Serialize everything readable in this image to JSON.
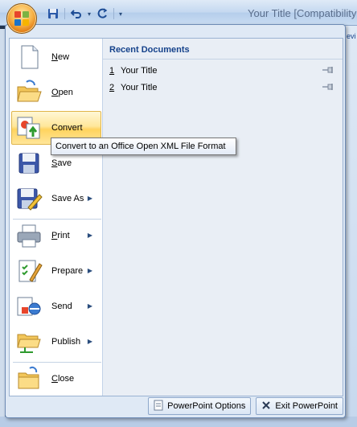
{
  "window": {
    "title": "Your Title [Compatibility"
  },
  "background": {
    "ribbon_fragment": "evi"
  },
  "menu": {
    "items": [
      {
        "label": "New",
        "mnemonic": "N",
        "rest": "ew",
        "icon": "new-document-icon",
        "submenu": false
      },
      {
        "label": "Open",
        "mnemonic": "O",
        "rest": "pen",
        "icon": "open-folder-icon",
        "submenu": false
      },
      {
        "label": "Convert",
        "mnemonic": "",
        "rest": "Convert",
        "icon": "convert-icon",
        "submenu": false
      },
      {
        "label": "Save",
        "mnemonic": "S",
        "rest": "ave",
        "icon": "save-icon",
        "submenu": false
      },
      {
        "label": "Save As",
        "mnemonic": "",
        "rest": "Save As",
        "icon": "save-as-icon",
        "submenu": true
      },
      {
        "label": "Print",
        "mnemonic": "P",
        "rest": "rint",
        "icon": "printer-icon",
        "submenu": true
      },
      {
        "label": "Prepare",
        "mnemonic": "",
        "rest": "Prepare",
        "icon": "prepare-icon",
        "submenu": true
      },
      {
        "label": "Send",
        "mnemonic": "",
        "rest": "Send",
        "icon": "send-icon",
        "submenu": true
      },
      {
        "label": "Publish",
        "mnemonic": "",
        "rest": "Publish",
        "icon": "publish-icon",
        "submenu": true
      },
      {
        "label": "Close",
        "mnemonic": "C",
        "rest": "lose",
        "icon": "close-folder-icon",
        "submenu": false
      }
    ],
    "highlighted": "Convert"
  },
  "recent": {
    "heading": "Recent Documents",
    "items": [
      {
        "num": "1",
        "title": "Your Title"
      },
      {
        "num": "2",
        "title": "Your Title"
      }
    ]
  },
  "tooltip": {
    "text": "Convert to an Office Open XML File Format"
  },
  "footer": {
    "options_label": "PowerPoint Options",
    "exit_label": "Exit PowerPoint"
  }
}
